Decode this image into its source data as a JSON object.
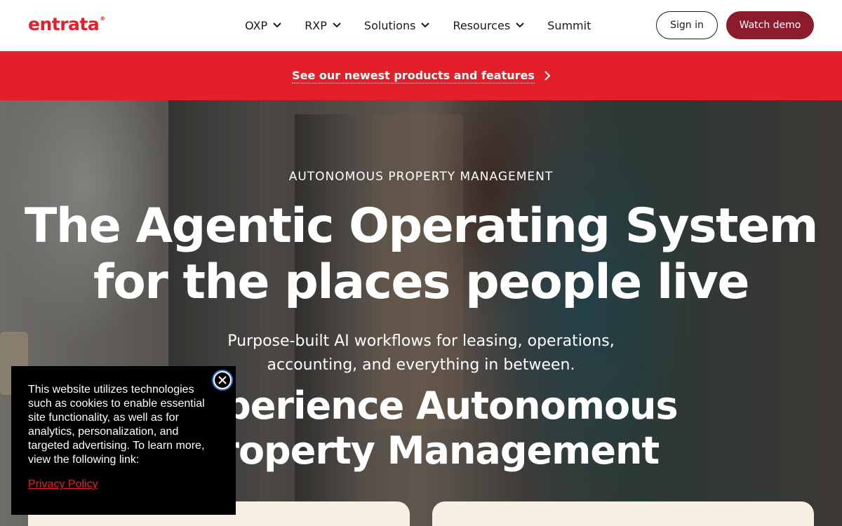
{
  "header": {
    "logo": "entrata",
    "logo_mark": "®",
    "nav": [
      {
        "label": "OXP",
        "icon": "chevron-down-icon"
      },
      {
        "label": "RXP",
        "icon": "chevron-down-icon"
      },
      {
        "label": "Solutions",
        "icon": "chevron-down-icon"
      },
      {
        "label": "Resources",
        "icon": "chevron-down-icon"
      },
      {
        "label": "Summit"
      }
    ],
    "signin_label": "Sign in",
    "demo_label": "Watch demo"
  },
  "announcement": {
    "link_text": "See our newest products and features",
    "icon": "chevron-right-icon"
  },
  "hero": {
    "eyebrow": "AUTONOMOUS PROPERTY MANAGEMENT",
    "headline_line1": "The Agentic Operating System",
    "headline_line2": "for the places people live",
    "subhead_line1": "Purpose-built AI workflows for leasing, operations,",
    "subhead_line2": "accounting, and everything in between.",
    "section_title_line1": "Experience Autonomous",
    "section_title_line2": "Property Management"
  },
  "cookie": {
    "text": "This website utilizes technologies such as cookies to enable essential site functionality, as well as for analytics, personalization, and targeted advertising. To learn more, view the following link:",
    "link": "Privacy Policy",
    "close_icon": "close-icon"
  },
  "colors": {
    "brand_red": "#e3202a",
    "demo_button": "#8c1c2c",
    "card_bg": "#f6efe4"
  }
}
